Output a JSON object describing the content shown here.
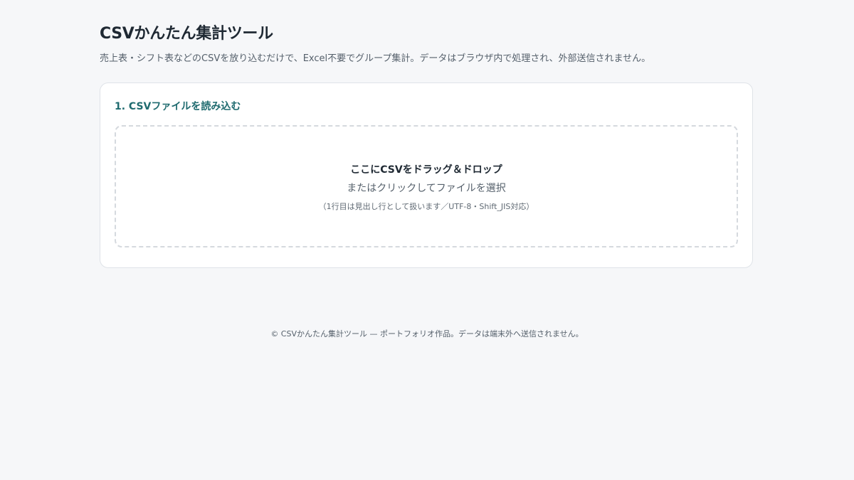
{
  "header": {
    "title": "CSVかんたん集計ツール",
    "subtitle": "売上表・シフト表などのCSVを放り込むだけで、Excel不要でグループ集計。データはブラウザ内で処理され、外部送信されません。"
  },
  "main": {
    "section1": {
      "heading": "1. CSVファイルを読み込む",
      "dropzone": {
        "primary": "ここにCSVをドラッグ＆ドロップ",
        "secondary": "またはクリックしてファイルを選択",
        "note": "（1行目は見出し行として扱います／UTF-8・Shift_JIS対応）"
      }
    }
  },
  "footer": {
    "text": "© CSVかんたん集計ツール — ポートフォリオ作品。データは端末外へ送信されません。"
  }
}
